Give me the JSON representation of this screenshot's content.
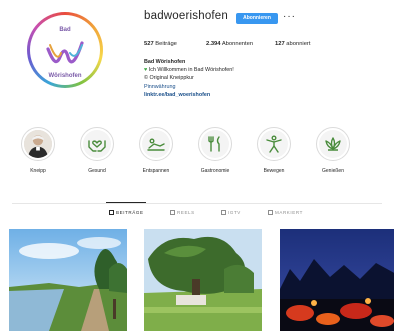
{
  "profile": {
    "username": "badwoerishofen",
    "follow_label": "Abonnieren",
    "more_icon": "more-icon",
    "avatar_logo_text": "Bad Wörishofen",
    "stats": {
      "posts": "527",
      "posts_label": "Beiträge",
      "followers": "2.394",
      "followers_label": "Abonnenten",
      "following": "127",
      "following_label": "abonniert"
    },
    "bio": {
      "name": "Bad Wörishofen",
      "line1": "Ich Willkommen in Bad Wörishofen!",
      "line2": "© Original Kneippkur",
      "line3": "Pinnwährung",
      "link": "linktr.ee/bad_woerishofen"
    }
  },
  "highlights": [
    {
      "label": "Kneipp",
      "icon": "portrait-icon"
    },
    {
      "label": "Gesund",
      "icon": "hands-heart-icon"
    },
    {
      "label": "Entspannen",
      "icon": "relax-icon"
    },
    {
      "label": "Gastronomie",
      "icon": "cutlery-icon"
    },
    {
      "label": "Bewegen",
      "icon": "person-stretch-icon"
    },
    {
      "label": "Genießen",
      "icon": "lotus-icon"
    }
  ],
  "tabs": [
    {
      "label": "BEITRÄGE",
      "active": true,
      "icon": "grid-icon"
    },
    {
      "label": "REELS",
      "active": false,
      "icon": "reels-icon"
    },
    {
      "label": "IGTV",
      "active": false,
      "icon": "igtv-icon"
    },
    {
      "label": "MARKIERT",
      "active": false,
      "icon": "tagged-icon"
    }
  ],
  "posts": [
    {
      "subject": "river-path"
    },
    {
      "subject": "tree-park"
    },
    {
      "subject": "night-lights"
    }
  ],
  "colors": {
    "accent_blue": "#3897f0",
    "highlight_green": "#4a8c3c",
    "link_blue": "#1a4f8a"
  }
}
